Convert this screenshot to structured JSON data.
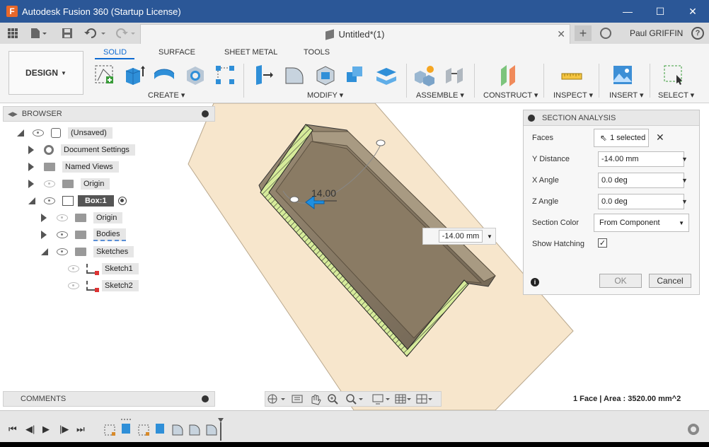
{
  "window": {
    "title": "Autodesk Fusion 360 (Startup License)",
    "logo": "F",
    "controls": [
      "—",
      "☐",
      "✕"
    ]
  },
  "quick_access": {
    "doc_tab_title": "Untitled*(1)",
    "user_name": "Paul GRIFFIN",
    "help": "?"
  },
  "toolbar": {
    "workspace": "DESIGN",
    "tabs": [
      "SOLID",
      "SURFACE",
      "SHEET METAL",
      "TOOLS"
    ],
    "active_tab": "SOLID",
    "groups": [
      "CREATE",
      "MODIFY",
      "ASSEMBLE",
      "CONSTRUCT",
      "INSPECT",
      "INSERT",
      "SELECT"
    ]
  },
  "browser": {
    "title": "BROWSER",
    "items": [
      {
        "label": "(Unsaved)"
      },
      {
        "label": "Document Settings"
      },
      {
        "label": "Named Views"
      },
      {
        "label": "Origin"
      },
      {
        "label": "Box:1"
      },
      {
        "label": "Origin"
      },
      {
        "label": "Bodies"
      },
      {
        "label": "Sketches"
      },
      {
        "label": "Sketch1"
      },
      {
        "label": "Sketch2"
      }
    ]
  },
  "viewport": {
    "dimension_label": "14.00",
    "distance_input": "-14.00 mm"
  },
  "section_analysis": {
    "title": "SECTION ANALYSIS",
    "faces_label": "Faces",
    "faces_value": "1 selected",
    "y_distance_label": "Y Distance",
    "y_distance_value": "-14.00 mm",
    "x_angle_label": "X Angle",
    "x_angle_value": "0.0 deg",
    "z_angle_label": "Z Angle",
    "z_angle_value": "0.0 deg",
    "section_color_label": "Section Color",
    "section_color_value": "From Component",
    "show_hatching_label": "Show Hatching",
    "show_hatching_checked": true,
    "ok_label": "OK",
    "cancel_label": "Cancel"
  },
  "comments": {
    "title": "COMMENTS"
  },
  "status": {
    "text": "1 Face | Area : 3520.00 mm^2"
  },
  "colors": {
    "titlebar": "#2b5797",
    "accent": "#0d6ad1",
    "body_tan": "#8c7d66",
    "hatch": "#c8e08a",
    "plane": "#f7e6cc"
  }
}
